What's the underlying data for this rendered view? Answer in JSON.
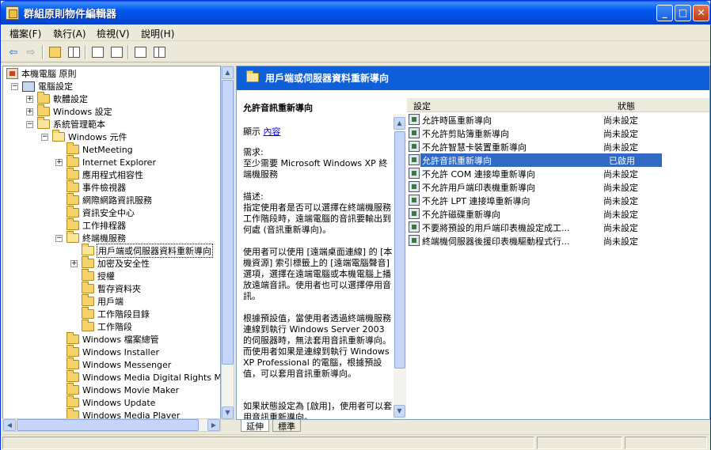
{
  "window": {
    "title": "群組原則物件編輯器"
  },
  "menu": [
    "檔案(F)",
    "執行(A)",
    "檢視(V)",
    "說明(H)"
  ],
  "toolbar": [
    "back",
    "forward",
    "up-folder",
    "show-hide-tree",
    "properties",
    "export-list",
    "help",
    "show-hide-pane"
  ],
  "tree": [
    {
      "label": "本機電腦 原則",
      "icon": "policy-icon"
    },
    {
      "label": "電腦設定",
      "icon": "computer-icon",
      "expander": "−"
    },
    {
      "label": "軟體設定",
      "icon": "folder-icon",
      "expander": "+"
    },
    {
      "label": "Windows 設定",
      "icon": "folder-icon",
      "expander": "+"
    },
    {
      "label": "系統管理範本",
      "icon": "folder-icon",
      "expander": "−"
    },
    {
      "label": "Windows 元件",
      "icon": "folder-icon",
      "expander": "−"
    },
    {
      "label": "NetMeeting",
      "icon": "folder-icon"
    },
    {
      "label": "Internet Explorer",
      "icon": "folder-icon",
      "expander": "+"
    },
    {
      "label": "應用程式相容性",
      "icon": "folder-icon"
    },
    {
      "label": "事件檢視器",
      "icon": "folder-icon"
    },
    {
      "label": "網際網路資訊服務",
      "icon": "folder-icon"
    },
    {
      "label": "資訊安全中心",
      "icon": "folder-icon"
    },
    {
      "label": "工作排程器",
      "icon": "folder-icon"
    },
    {
      "label": "終端機服務",
      "icon": "folder-icon",
      "expander": "−"
    },
    {
      "label": "用戶端或伺服器資料重新導向",
      "icon": "folder-icon",
      "selected": true
    },
    {
      "label": "加密及安全性",
      "icon": "folder-icon",
      "expander": "+"
    },
    {
      "label": "授權",
      "icon": "folder-icon"
    },
    {
      "label": "暫存資料夾",
      "icon": "folder-icon"
    },
    {
      "label": "用戶端",
      "icon": "folder-icon"
    },
    {
      "label": "工作階段目錄",
      "icon": "folder-icon"
    },
    {
      "label": "工作階段",
      "icon": "folder-icon"
    },
    {
      "label": "Windows 檔案總管",
      "icon": "folder-icon"
    },
    {
      "label": "Windows Installer",
      "icon": "folder-icon"
    },
    {
      "label": "Windows Messenger",
      "icon": "folder-icon"
    },
    {
      "label": "Windows Media Digital Rights Mana",
      "icon": "folder-icon"
    },
    {
      "label": "Windows Movie Maker",
      "icon": "folder-icon"
    },
    {
      "label": "Windows Update",
      "icon": "folder-icon"
    },
    {
      "label": "Windows Media Player",
      "icon": "folder-icon"
    }
  ],
  "pane": {
    "banner_title": "用戶端或伺服器資料重新導向",
    "ext": {
      "heading": "允許音訊重新導向",
      "show_label": "顯示",
      "show_link": "內容",
      "requirements": "需求:\n至少需要 Microsoft Windows XP 終端機服務",
      "description": "描述:\n指定使用者是否可以選擇在終端機服務工作階段時，遠端電腦的音訊要輸出到何處 (音訊重新導向)。",
      "para2": "使用者可以使用 [遠端桌面連線] 的 [本機資源] 索引標籤上的 [遠端電腦聲音] 選項，選擇在遠端電腦或本機電腦上播放遠端音訊。使用者也可以選擇停用音訊。",
      "para3": "根據預設值，當使用者透過終端機服務連線到執行 Windows Server 2003 的伺服器時，無法套用音訊重新導向。而使用者如果是連線到執行 Windows XP Professional 的電腦，根據預設值，可以套用音訊重新導向。",
      "para4": "如果狀態設定為 [啟用]，使用者可以套用音訊重新導向。"
    },
    "list": {
      "col_setting": "設定",
      "col_state": "狀態",
      "rows": [
        {
          "name": "允許時區重新導向",
          "state": "尚未設定"
        },
        {
          "name": "不允許剪貼簿重新導向",
          "state": "尚未設定"
        },
        {
          "name": "不允許智慧卡裝置重新導向",
          "state": "尚未設定"
        },
        {
          "name": "允許音訊重新導向",
          "state": "已啟用",
          "selected": true
        },
        {
          "name": "不允許 COM 連接埠重新導向",
          "state": "尚未設定"
        },
        {
          "name": "不允許用戶端印表機重新導向",
          "state": "尚未設定"
        },
        {
          "name": "不允許 LPT 連接埠重新導向",
          "state": "尚未設定"
        },
        {
          "name": "不允許磁碟重新導向",
          "state": "尚未設定"
        },
        {
          "name": "不要將預設的用戶端印表機設定成工...",
          "state": "尚未設定"
        },
        {
          "name": "終端機伺服器後援印表機驅動程式行...",
          "state": "尚未設定"
        }
      ]
    }
  },
  "tabs": [
    "延伸",
    "標準"
  ]
}
